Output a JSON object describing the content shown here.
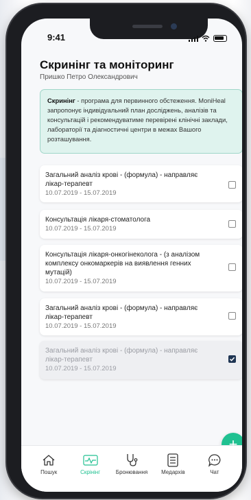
{
  "status": {
    "time": "9:41"
  },
  "header": {
    "title": "Скринінг та моніторинг",
    "patient": "Пришко Петро Олександрович"
  },
  "info": {
    "bold": "Скринінг",
    "text": " - програма для первинного обстеження. MoniHeal запропонує індивідуальний план досліджень, аналізів та консультацій і рекомендуватиме перевірені клінічні заклади, лабораторії та діагностичні центри в межах Вашого розташування."
  },
  "items": [
    {
      "name": "Загальний аналіз крові - (формула) - направляє лікар-терапевт",
      "date": "10.07.2019 - 15.07.2019",
      "checked": false
    },
    {
      "name": "Консультація лікаря-стоматолога",
      "date": "10.07.2019 - 15.07.2019",
      "checked": false
    },
    {
      "name": "Консультація лікаря-онкогінеколога - (з аналізом комплексу онкомаркерів на виявлення генних мутацій)",
      "date": "10.07.2019 - 15.07.2019",
      "checked": false
    },
    {
      "name": "Загальний аналіз крові - (формула) - направляє лікар-терапевт",
      "date": "10.07.2019 - 15.07.2019",
      "checked": false
    },
    {
      "name": "Загальний аналіз крові - (формула) - направляє лікар-терапевт",
      "date": "10.07.2019 - 15.07.2019",
      "checked": true
    }
  ],
  "fab": {
    "label": "+"
  },
  "tabs": [
    {
      "label": "Пошук",
      "icon": "home-icon",
      "active": false
    },
    {
      "label": "Скрінінг",
      "icon": "pulse-icon",
      "active": true
    },
    {
      "label": "Бронювання",
      "icon": "stethoscope-icon",
      "active": false
    },
    {
      "label": "Медархів",
      "icon": "document-icon",
      "active": false
    },
    {
      "label": "Чат",
      "icon": "chat-icon",
      "active": false
    }
  ],
  "colors": {
    "accent": "#20c191",
    "check": "#1f3553",
    "info_bg": "#dff3ee"
  }
}
